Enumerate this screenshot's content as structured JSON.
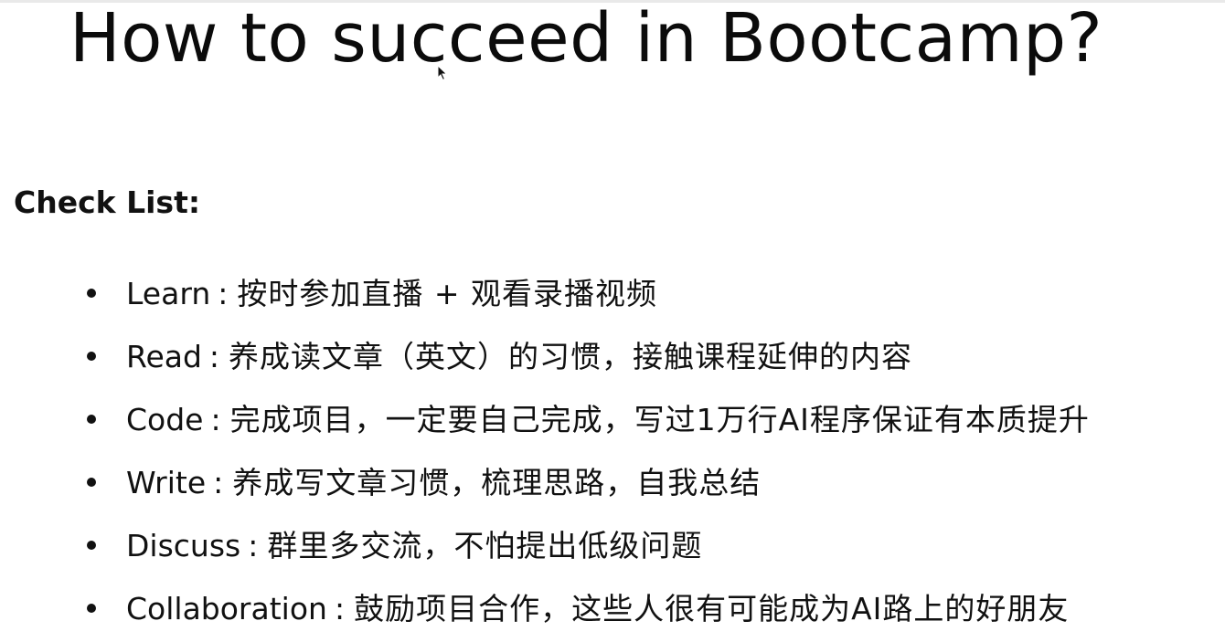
{
  "slide": {
    "title": "How to succeed in Bootcamp?",
    "checklist_heading": "Check List:",
    "items": [
      {
        "key": "Learn",
        "colon": ":",
        "desc": "按时参加直播 + 观看录播视频"
      },
      {
        "key": "Read",
        "colon": ":",
        "desc": "养成读文章（英文）的习惯，接触课程延伸的内容"
      },
      {
        "key": "Code",
        "colon": ":",
        "desc": "完成项目，一定要自己完成，写过1万行AI程序保证有本质提升"
      },
      {
        "key": "Write",
        "colon": ":",
        "desc": "养成写文章习惯，梳理思路，自我总结"
      },
      {
        "key": "Discuss",
        "colon": ":",
        "desc": "群里多交流，不怕提出低级问题"
      },
      {
        "key": "Collaboration",
        "colon": ":",
        "desc": "鼓励项目合作，这些人很有可能成为AI路上的好朋友"
      }
    ]
  },
  "icons": {
    "cursor": "mouse-pointer-icon",
    "bullet": "bullet-dot-icon"
  },
  "colors": {
    "background": "#ffffff",
    "text": "#111111"
  }
}
